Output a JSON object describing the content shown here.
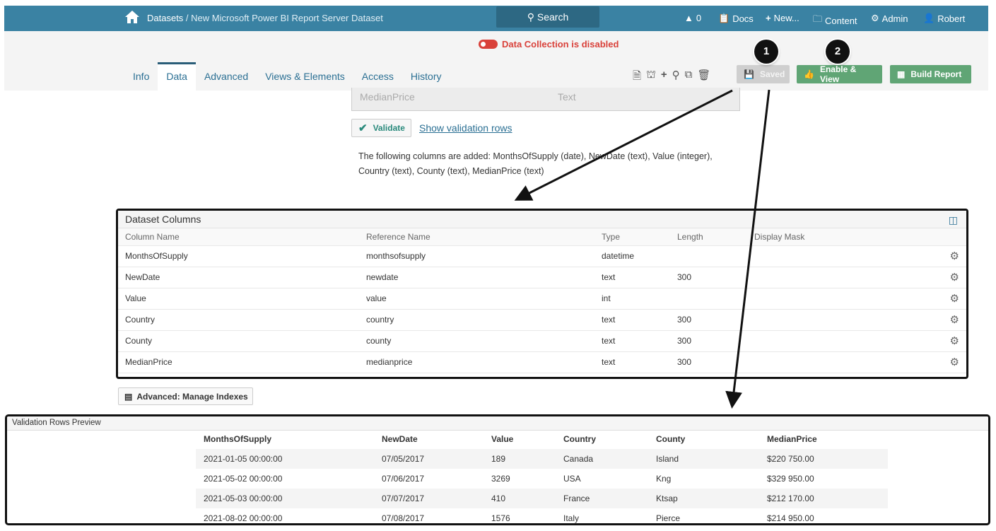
{
  "header": {
    "breadcrumb_root": "Datasets",
    "breadcrumb_sep": " / ",
    "breadcrumb_current": "New Microsoft Power BI Report Server Dataset",
    "search_label": "Search",
    "alerts_count": "0",
    "docs": "Docs",
    "new": "New...",
    "content": "Content",
    "admin": "Admin",
    "user": "Robert"
  },
  "status": {
    "data_collection": "Data Collection is disabled"
  },
  "tabs": [
    {
      "label": "Info"
    },
    {
      "label": "Data"
    },
    {
      "label": "Advanced"
    },
    {
      "label": "Views & Elements"
    },
    {
      "label": "Access"
    },
    {
      "label": "History"
    }
  ],
  "toolbar": {
    "saved": "Saved",
    "enable_view": "Enable & View",
    "build_report": "Build Report"
  },
  "callouts": [
    "1",
    "2"
  ],
  "column_preview": {
    "name": "MedianPrice",
    "type": "Text"
  },
  "validate": {
    "button": "Validate",
    "link": "Show validation rows",
    "message": "The following columns are added: MonthsOfSupply (date), NewDate (text), Value (integer), Country (text), County (text), MedianPrice (text)"
  },
  "dataset_columns": {
    "title": "Dataset Columns",
    "headers": [
      "Column Name",
      "Reference Name",
      "Type",
      "Length",
      "Display Mask"
    ],
    "rows": [
      [
        "MonthsOfSupply",
        "monthsofsupply",
        "datetime",
        "",
        ""
      ],
      [
        "NewDate",
        "newdate",
        "text",
        "300",
        ""
      ],
      [
        "Value",
        "value",
        "int",
        "",
        ""
      ],
      [
        "Country",
        "country",
        "text",
        "300",
        ""
      ],
      [
        "County",
        "county",
        "text",
        "300",
        ""
      ],
      [
        "MedianPrice",
        "medianprice",
        "text",
        "300",
        ""
      ]
    ]
  },
  "manage_indexes": "Advanced: Manage Indexes",
  "validation_preview": {
    "title": "Validation Rows Preview",
    "headers": [
      "MonthsOfSupply",
      "NewDate",
      "Value",
      "Country",
      "County",
      "MedianPrice"
    ],
    "rows": [
      [
        "2021-01-05 00:00:00",
        "07/05/2017",
        "189",
        "Canada",
        "Island",
        "$220 750.00"
      ],
      [
        "2021-05-02 00:00:00",
        "07/06/2017",
        "3269",
        "USA",
        "Kng",
        "$329 950.00"
      ],
      [
        "2021-05-03 00:00:00",
        "07/07/2017",
        "410",
        "France",
        "Ktsap",
        "$212 170.00"
      ],
      [
        "2021-08-02 00:00:00",
        "07/08/2017",
        "1576",
        "Italy",
        "Pierce",
        "$214 950.00"
      ]
    ]
  }
}
